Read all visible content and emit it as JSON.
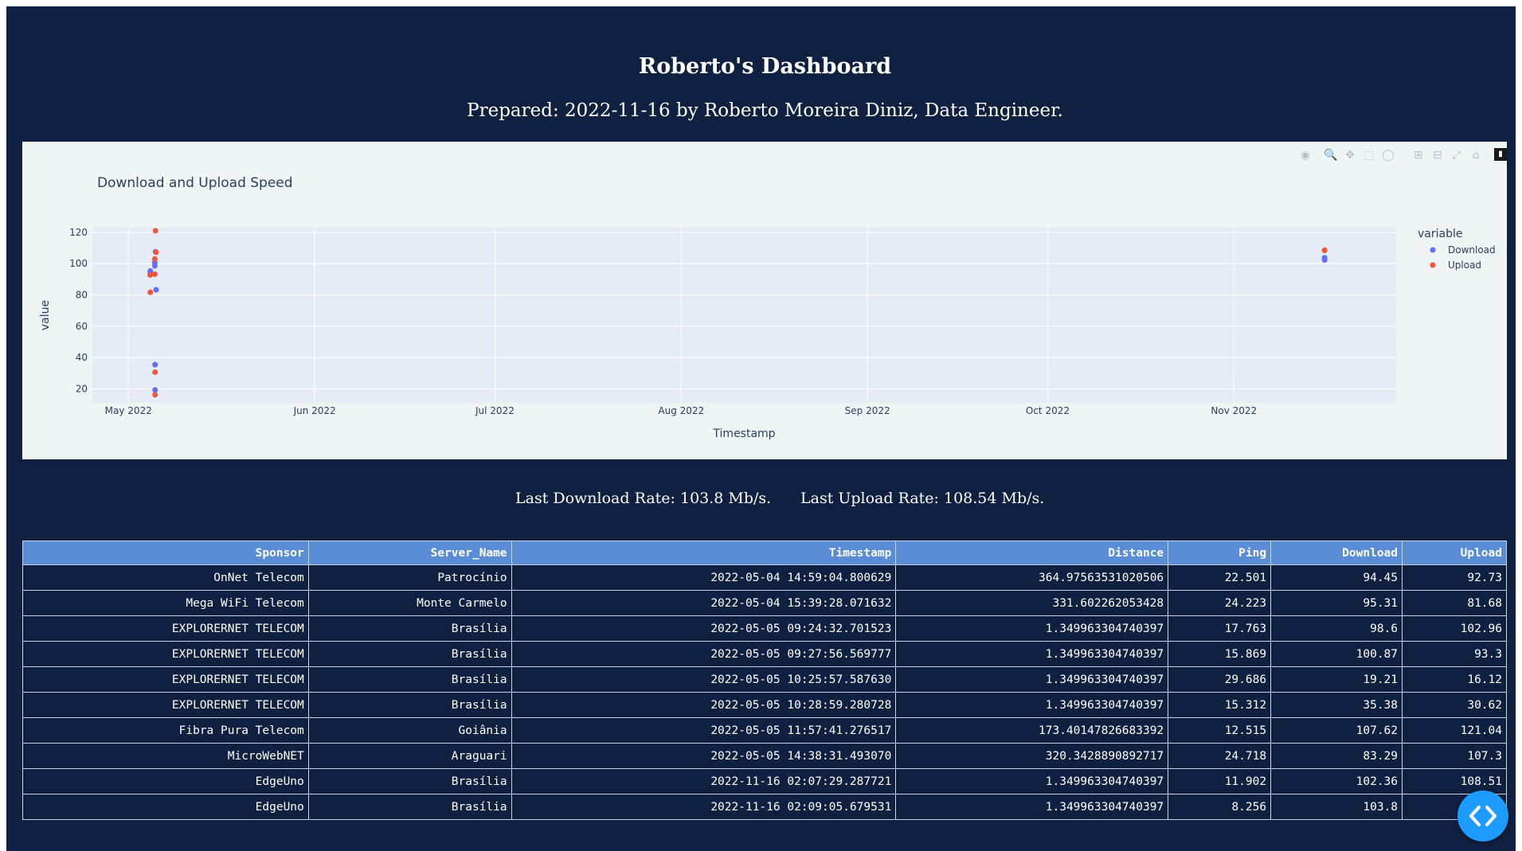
{
  "header": {
    "title": "Roberto's Dashboard",
    "subtitle": "Prepared: 2022-11-16 by Roberto Moreira Diniz, Data Engineer."
  },
  "modebar": {
    "icons": [
      "camera-icon",
      "zoom-icon",
      "pan-icon",
      "box-select-icon",
      "lasso-icon",
      "zoom-in-icon",
      "zoom-out-icon",
      "autoscale-icon",
      "reset-axes-icon",
      "plotly-logo-icon"
    ]
  },
  "chart_data": {
    "type": "scatter",
    "title": "Download and Upload Speed",
    "xlabel": "Timestamp",
    "ylabel": "value",
    "legend_title": "variable",
    "legend_position": "right",
    "grid": true,
    "xlim": [
      "2022-04-25",
      "2022-11-28"
    ],
    "ylim": [
      11,
      123
    ],
    "x_ticks": [
      "2022-05-01",
      "2022-06-01",
      "2022-07-01",
      "2022-08-01",
      "2022-09-01",
      "2022-10-01",
      "2022-11-01"
    ],
    "x_tick_labels": [
      "May 2022",
      "Jun 2022",
      "Jul 2022",
      "Aug 2022",
      "Sep 2022",
      "Oct 2022",
      "Nov 2022"
    ],
    "y_ticks": [
      20,
      40,
      60,
      80,
      100,
      120
    ],
    "x": [
      "2022-05-04 14:59:04",
      "2022-05-04 15:39:28",
      "2022-05-05 09:24:32",
      "2022-05-05 09:27:56",
      "2022-05-05 10:25:57",
      "2022-05-05 10:28:59",
      "2022-05-05 11:57:41",
      "2022-05-05 14:38:31",
      "2022-11-16 02:07:29",
      "2022-11-16 02:09:05"
    ],
    "series": [
      {
        "name": "Download",
        "color": "#636efa",
        "values": [
          94.45,
          95.31,
          98.6,
          100.87,
          19.21,
          35.38,
          107.62,
          83.29,
          102.36,
          103.8
        ]
      },
      {
        "name": "Upload",
        "color": "#ef553b",
        "values": [
          92.73,
          81.68,
          102.96,
          93.3,
          16.12,
          30.62,
          121.04,
          107.3,
          108.51,
          108.54
        ]
      }
    ]
  },
  "rates": {
    "download": "Last Download Rate: 103.8 Mb/s.",
    "upload": "Last Upload Rate: 108.54 Mb/s."
  },
  "table": {
    "columns": [
      "Sponsor",
      "Server_Name",
      "Timestamp",
      "Distance",
      "Ping",
      "Download",
      "Upload"
    ],
    "rows": [
      [
        "OnNet Telecom",
        "Patrocínio",
        "2022-05-04 14:59:04.800629",
        "364.97563531020506",
        "22.501",
        "94.45",
        "92.73"
      ],
      [
        "Mega WiFi Telecom",
        "Monte Carmelo",
        "2022-05-04 15:39:28.071632",
        "331.602262053428",
        "24.223",
        "95.31",
        "81.68"
      ],
      [
        "EXPLORERNET TELECOM",
        "Brasília",
        "2022-05-05 09:24:32.701523",
        "1.349963304740397",
        "17.763",
        "98.6",
        "102.96"
      ],
      [
        "EXPLORERNET TELECOM",
        "Brasília",
        "2022-05-05 09:27:56.569777",
        "1.349963304740397",
        "15.869",
        "100.87",
        "93.3"
      ],
      [
        "EXPLORERNET TELECOM",
        "Brasília",
        "2022-05-05 10:25:57.587630",
        "1.349963304740397",
        "29.686",
        "19.21",
        "16.12"
      ],
      [
        "EXPLORERNET TELECOM",
        "Brasília",
        "2022-05-05 10:28:59.280728",
        "1.349963304740397",
        "15.312",
        "35.38",
        "30.62"
      ],
      [
        "Fibra Pura Telecom",
        "Goiânia",
        "2022-05-05 11:57:41.276517",
        "173.40147826683392",
        "12.515",
        "107.62",
        "121.04"
      ],
      [
        "MicroWebNET",
        "Araguari",
        "2022-05-05 14:38:31.493070",
        "320.3428890892717",
        "24.718",
        "83.29",
        "107.3"
      ],
      [
        "EdgeUno",
        "Brasília",
        "2022-11-16 02:07:29.287721",
        "1.349963304740397",
        "11.902",
        "102.36",
        "108.51"
      ],
      [
        "EdgeUno",
        "Brasília",
        "2022-11-16 02:09:05.679531",
        "1.349963304740397",
        "8.256",
        "103.8",
        "108.54"
      ]
    ]
  }
}
